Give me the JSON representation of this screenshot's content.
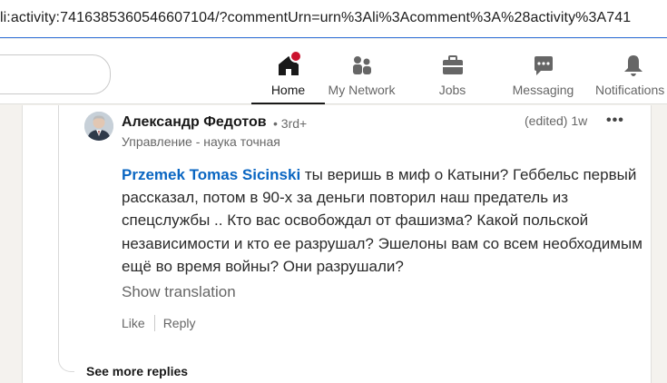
{
  "browser": {
    "url": "li:activity:7416385360546607104/?commentUrn=urn%3Ali%3Acomment%3A%28activity%3A741"
  },
  "nav": {
    "items": [
      {
        "label": "Home",
        "icon": "home-icon"
      },
      {
        "label": "My Network",
        "icon": "my-network-icon"
      },
      {
        "label": "Jobs",
        "icon": "jobs-icon"
      },
      {
        "label": "Messaging",
        "icon": "messaging-icon"
      },
      {
        "label": "Notifications",
        "icon": "notifications-icon"
      }
    ],
    "active": "Home",
    "notification_color": "#cb112d"
  },
  "comment": {
    "author": "Александр Федотов",
    "degree": "• 3rd+",
    "headline": "Управление - наука точная",
    "timestamp": "(edited) 1w",
    "more": "•••",
    "mention": "Przemek Tomas Sicinski",
    "text": " ты веришь в миф о Катыни? Геббельс первый рассказал, потом в 90-х за деньги повторил наш предатель из спецслужбы .. Кто вас освобождал от фашизма? Какой польской независимости и кто ее разрушал? Эшелоны вам со всем необходимым ещё во время войны? Они разрушали?",
    "show_translation": "Show translation",
    "like": "Like",
    "reply": "Reply"
  },
  "see_more_replies": "See more replies",
  "colors": {
    "accent": "#0a66c2",
    "background": "#f4f2ee"
  }
}
